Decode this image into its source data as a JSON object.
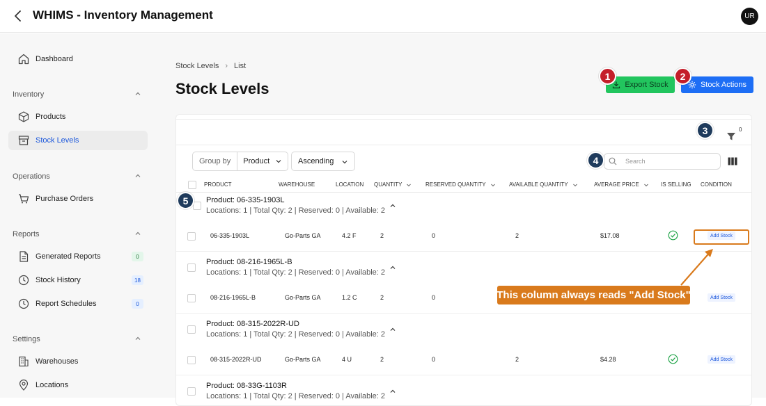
{
  "header": {
    "title": "WHIMS - Inventory Management",
    "avatar": "UR"
  },
  "sidebar": {
    "dashboard": "Dashboard",
    "sections": {
      "inventory": "Inventory",
      "operations": "Operations",
      "reports": "Reports",
      "settings": "Settings"
    },
    "items": {
      "products": "Products",
      "stock_levels": "Stock Levels",
      "purchase_orders": "Purchase Orders",
      "generated_reports": {
        "label": "Generated Reports",
        "count": "0"
      },
      "stock_history": {
        "label": "Stock History",
        "count": "18"
      },
      "report_schedules": {
        "label": "Report Schedules",
        "count": "0"
      },
      "warehouses": "Warehouses",
      "locations": "Locations"
    }
  },
  "breadcrumb": {
    "parent": "Stock Levels",
    "current": "List"
  },
  "page": {
    "title": "Stock Levels"
  },
  "actions": {
    "export": "Export Stock",
    "stock_actions": "Stock Actions"
  },
  "filter": {
    "count": "0"
  },
  "toolbar": {
    "group_by_label": "Group by",
    "group_by_value": "Product",
    "order_value": "Ascending",
    "search_placeholder": "Search"
  },
  "columns": [
    "Product",
    "Warehouse",
    "Location",
    "Quantity",
    "Reserved Quantity",
    "Available Quantity",
    "Average Price",
    "Is Selling",
    "Condition"
  ],
  "groups": [
    {
      "title": "Product: 06-335-1903L",
      "summary": "Locations: 1 | Total Qty: 2 | Reserved: 0 | Available: 2",
      "row": {
        "product": "06-335-1903L",
        "warehouse": "Go-Parts GA",
        "location": "4.2 F",
        "quantity": "2",
        "reserved": "0",
        "available": "2",
        "price": "$17.08",
        "condition": "Add Stock"
      }
    },
    {
      "title": "Product: 08-216-1965L-B",
      "summary": "Locations: 1 | Total Qty: 2 | Reserved: 0 | Available: 2",
      "row": {
        "product": "08-216-1965L-B",
        "warehouse": "Go-Parts GA",
        "location": "1.2 C",
        "quantity": "2",
        "reserved": "0",
        "available": "",
        "price": "",
        "condition": "Add Stock"
      }
    },
    {
      "title": "Product: 08-315-2022R-UD",
      "summary": "Locations: 1 | Total Qty: 2 | Reserved: 0 | Available: 2",
      "row": {
        "product": "08-315-2022R-UD",
        "warehouse": "Go-Parts GA",
        "location": "4 U",
        "quantity": "2",
        "reserved": "0",
        "available": "2",
        "price": "$4.28",
        "condition": "Add Stock"
      }
    },
    {
      "title": "Product: 08-33G-1103R",
      "summary": "Locations: 1 | Total Qty: 2 | Reserved: 0 | Available: 2"
    }
  ],
  "annotations": {
    "badges": [
      "1",
      "2",
      "3",
      "4",
      "5"
    ],
    "callout": "This column always reads \"Add Stock\"",
    "colors": {
      "badge_red": "#c41e2a",
      "badge_navy": "#1f3b5c",
      "callout": "#d97a1c"
    }
  }
}
